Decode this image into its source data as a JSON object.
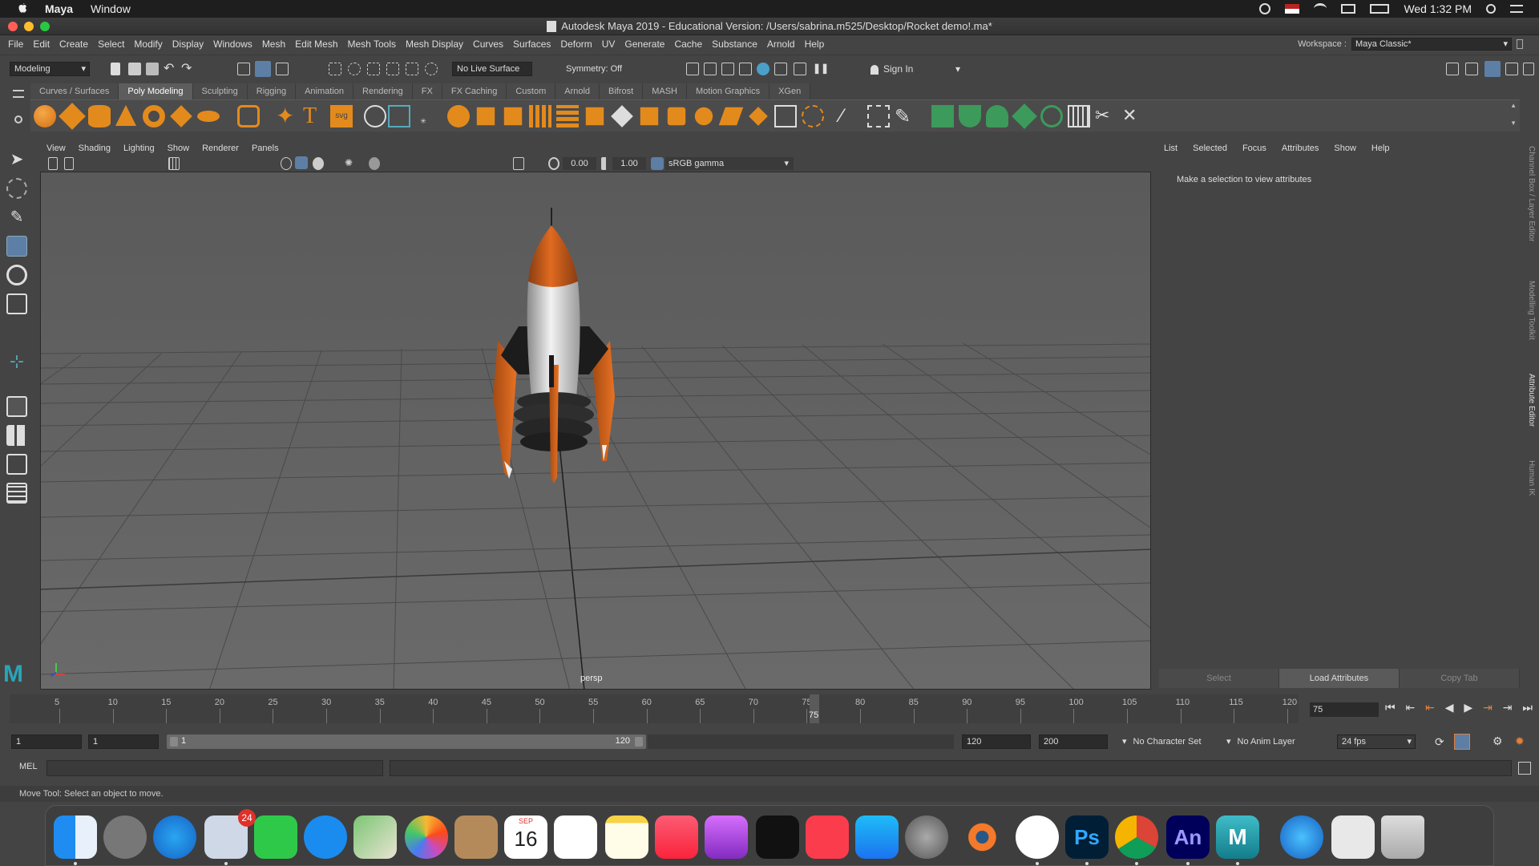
{
  "mac_menubar": {
    "app_name": "Maya",
    "items": [
      "Window"
    ],
    "clock": "Wed 1:32 PM"
  },
  "window": {
    "title": "Autodesk Maya 2019 - Educational Version: /Users/sabrina.m525/Desktop/Rocket demo!.ma*"
  },
  "maya_menu": [
    "File",
    "Edit",
    "Create",
    "Select",
    "Modify",
    "Display",
    "Windows",
    "Mesh",
    "Edit Mesh",
    "Mesh Tools",
    "Mesh Display",
    "Curves",
    "Surfaces",
    "Deform",
    "UV",
    "Generate",
    "Cache",
    "Substance",
    "Arnold",
    "Help"
  ],
  "workspace": {
    "label": "Workspace :",
    "value": "Maya Classic*"
  },
  "status_line": {
    "menu_set": "Modeling",
    "live_surface": "No Live Surface",
    "symmetry": "Symmetry: Off",
    "sign_in": "Sign In"
  },
  "shelf_tabs": [
    "Curves / Surfaces",
    "Poly Modeling",
    "Sculpting",
    "Rigging",
    "Animation",
    "Rendering",
    "FX",
    "FX Caching",
    "Custom",
    "Arnold",
    "Bifrost",
    "MASH",
    "Motion Graphics",
    "XGen"
  ],
  "active_shelf_tab": "Poly Modeling",
  "viewport": {
    "menu": [
      "View",
      "Shading",
      "Lighting",
      "Show",
      "Renderer",
      "Panels"
    ],
    "exposure": "0.00",
    "gamma": "1.00",
    "color_space": "sRGB gamma",
    "camera": "persp"
  },
  "attribute_editor": {
    "menu": [
      "List",
      "Selected",
      "Focus",
      "Attributes",
      "Show",
      "Help"
    ],
    "message": "Make a selection to view attributes",
    "buttons": [
      "Select",
      "Load Attributes",
      "Copy Tab"
    ]
  },
  "side_tabs": [
    "Channel Box / Layer Editor",
    "Modelling Toolkit",
    "Attribute Editor",
    "Human IK"
  ],
  "timeline": {
    "ticks": [
      "5",
      "10",
      "15",
      "20",
      "25",
      "30",
      "35",
      "40",
      "45",
      "50",
      "55",
      "60",
      "65",
      "70",
      "75",
      "80",
      "85",
      "90",
      "95",
      "100",
      "105",
      "110",
      "115",
      "120"
    ],
    "current_frame": "75",
    "current_frame_field": "75"
  },
  "range": {
    "start": "1",
    "anim_start": "1",
    "slider_start": "1",
    "slider_end": "120",
    "anim_end": "120",
    "end": "200",
    "character_set": "No Character Set",
    "anim_layer": "No Anim Layer",
    "fps": "24 fps"
  },
  "command_line": {
    "label": "MEL"
  },
  "help_line": "Move Tool: Select an object to move.",
  "dock": {
    "mail_badge": "24",
    "calendar_month": "SEP",
    "calendar_day": "16"
  }
}
